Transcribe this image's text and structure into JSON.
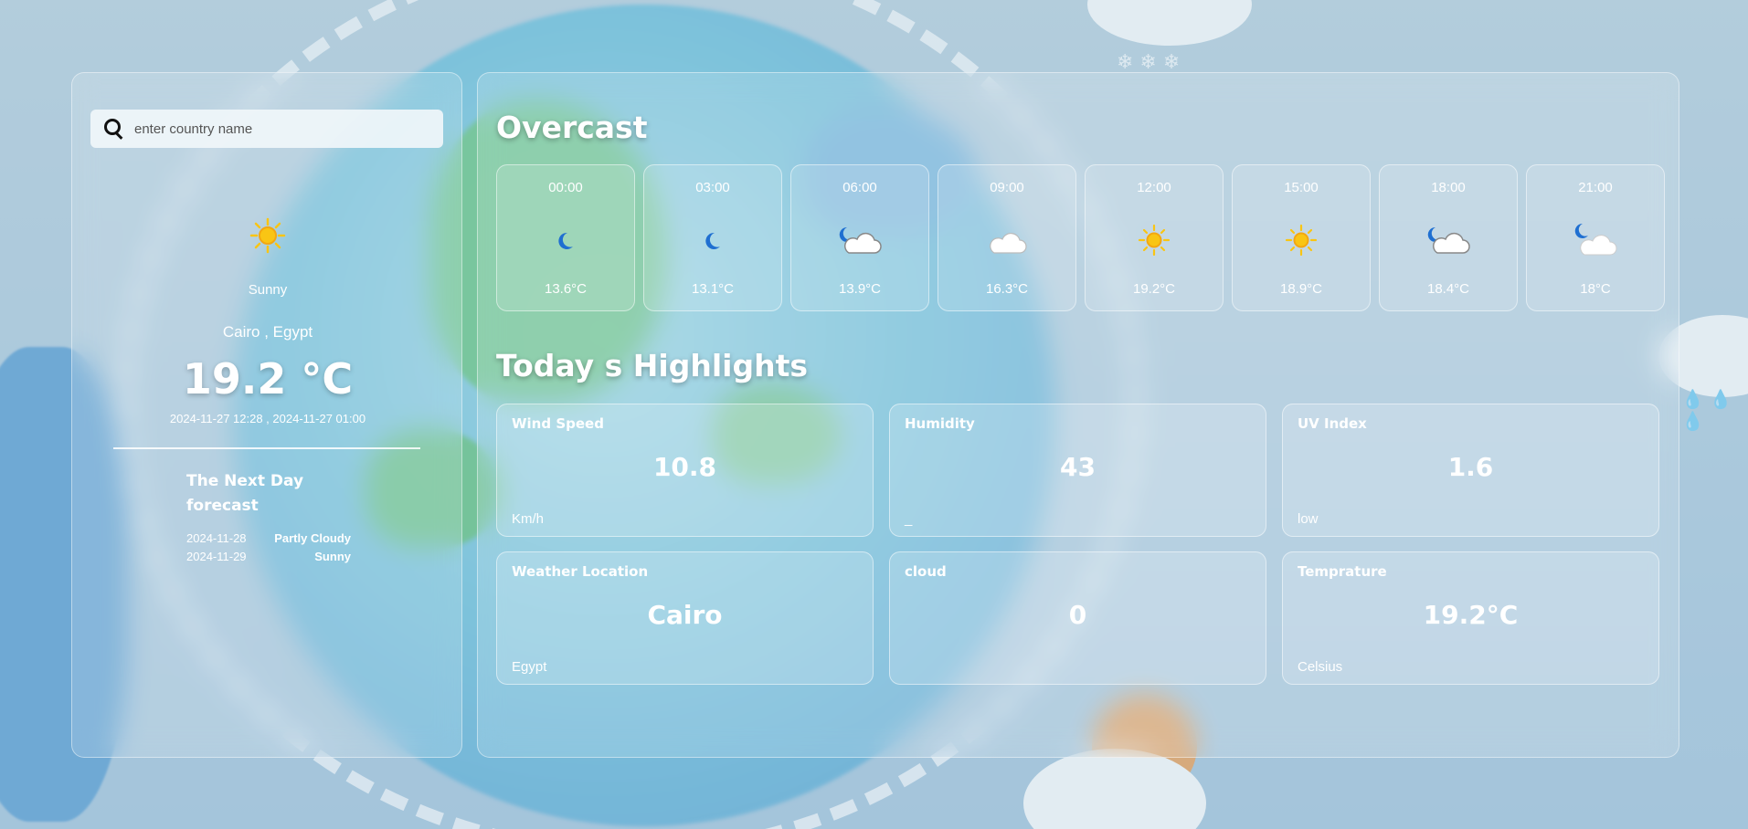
{
  "search": {
    "placeholder": "enter country name"
  },
  "current": {
    "icon": "sun-icon",
    "condition": "Sunny",
    "location": "Cairo , Egypt",
    "temperature": "19.2 °C",
    "dates": "2024-11-27 12:28 , 2024-11-27 01:00"
  },
  "next_forecast": {
    "title": "The Next Day forecast",
    "days": [
      {
        "date": "2024-11-28",
        "condition": "Partly Cloudy"
      },
      {
        "date": "2024-11-29",
        "condition": "Sunny"
      }
    ]
  },
  "main": {
    "condition_title": "Overcast",
    "hourly": [
      {
        "time": "00:00",
        "icon": "moon-icon",
        "temp": "13.6°C"
      },
      {
        "time": "03:00",
        "icon": "moon-icon",
        "temp": "13.1°C"
      },
      {
        "time": "06:00",
        "icon": "moon-cloud-icon",
        "temp": "13.9°C"
      },
      {
        "time": "09:00",
        "icon": "cloud-icon",
        "temp": "16.3°C"
      },
      {
        "time": "12:00",
        "icon": "sun-icon",
        "temp": "19.2°C"
      },
      {
        "time": "15:00",
        "icon": "sun-icon",
        "temp": "18.9°C"
      },
      {
        "time": "18:00",
        "icon": "moon-cloud-icon",
        "temp": "18.4°C"
      },
      {
        "time": "21:00",
        "icon": "moon-cloud-icon",
        "temp": "18°C"
      }
    ],
    "highlights_title": "Today s Highlights",
    "highlights": [
      {
        "label": "Wind Speed",
        "value": "10.8",
        "sub": "Km/h"
      },
      {
        "label": "Humidity",
        "value": "43",
        "sub": "_"
      },
      {
        "label": "UV Index",
        "value": "1.6",
        "sub": "low"
      },
      {
        "label": "Weather Location",
        "value": "Cairo",
        "sub": "Egypt"
      },
      {
        "label": "cloud",
        "value": "0",
        "sub": ""
      },
      {
        "label": "Temprature",
        "value": "19.2°C",
        "sub": "Celsius"
      }
    ]
  },
  "colors": {
    "sun": "#f9c514",
    "moon": "#1f6fd1",
    "cloud": "#ffffff"
  }
}
